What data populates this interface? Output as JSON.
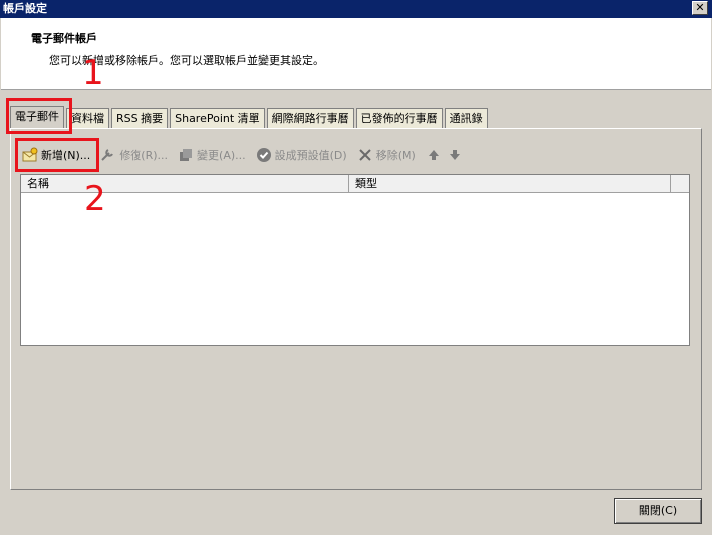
{
  "window": {
    "title": "帳戶設定",
    "close_glyph": "✕"
  },
  "header": {
    "title": "電子郵件帳戶",
    "description": "您可以新增或移除帳戶。您可以選取帳戶並變更其設定。"
  },
  "tabs": [
    {
      "label": "電子郵件"
    },
    {
      "label": "資料檔"
    },
    {
      "label": "RSS 摘要"
    },
    {
      "label": "SharePoint 清單"
    },
    {
      "label": "網際網路行事曆"
    },
    {
      "label": "已發佈的行事曆"
    },
    {
      "label": "通訊錄"
    }
  ],
  "toolbar": {
    "new_label": "新增(N)...",
    "repair_label": "修復(R)...",
    "change_label": "變更(A)...",
    "default_label": "設成預設值(D)",
    "remove_label": "移除(M)"
  },
  "list": {
    "columns": [
      "名稱",
      "類型"
    ]
  },
  "annotations": {
    "one": "1",
    "two": "2"
  },
  "footer": {
    "close_label": "關閉(C)"
  },
  "colors": {
    "annotation": "#e8141c",
    "title_bar": "#0a246a"
  }
}
